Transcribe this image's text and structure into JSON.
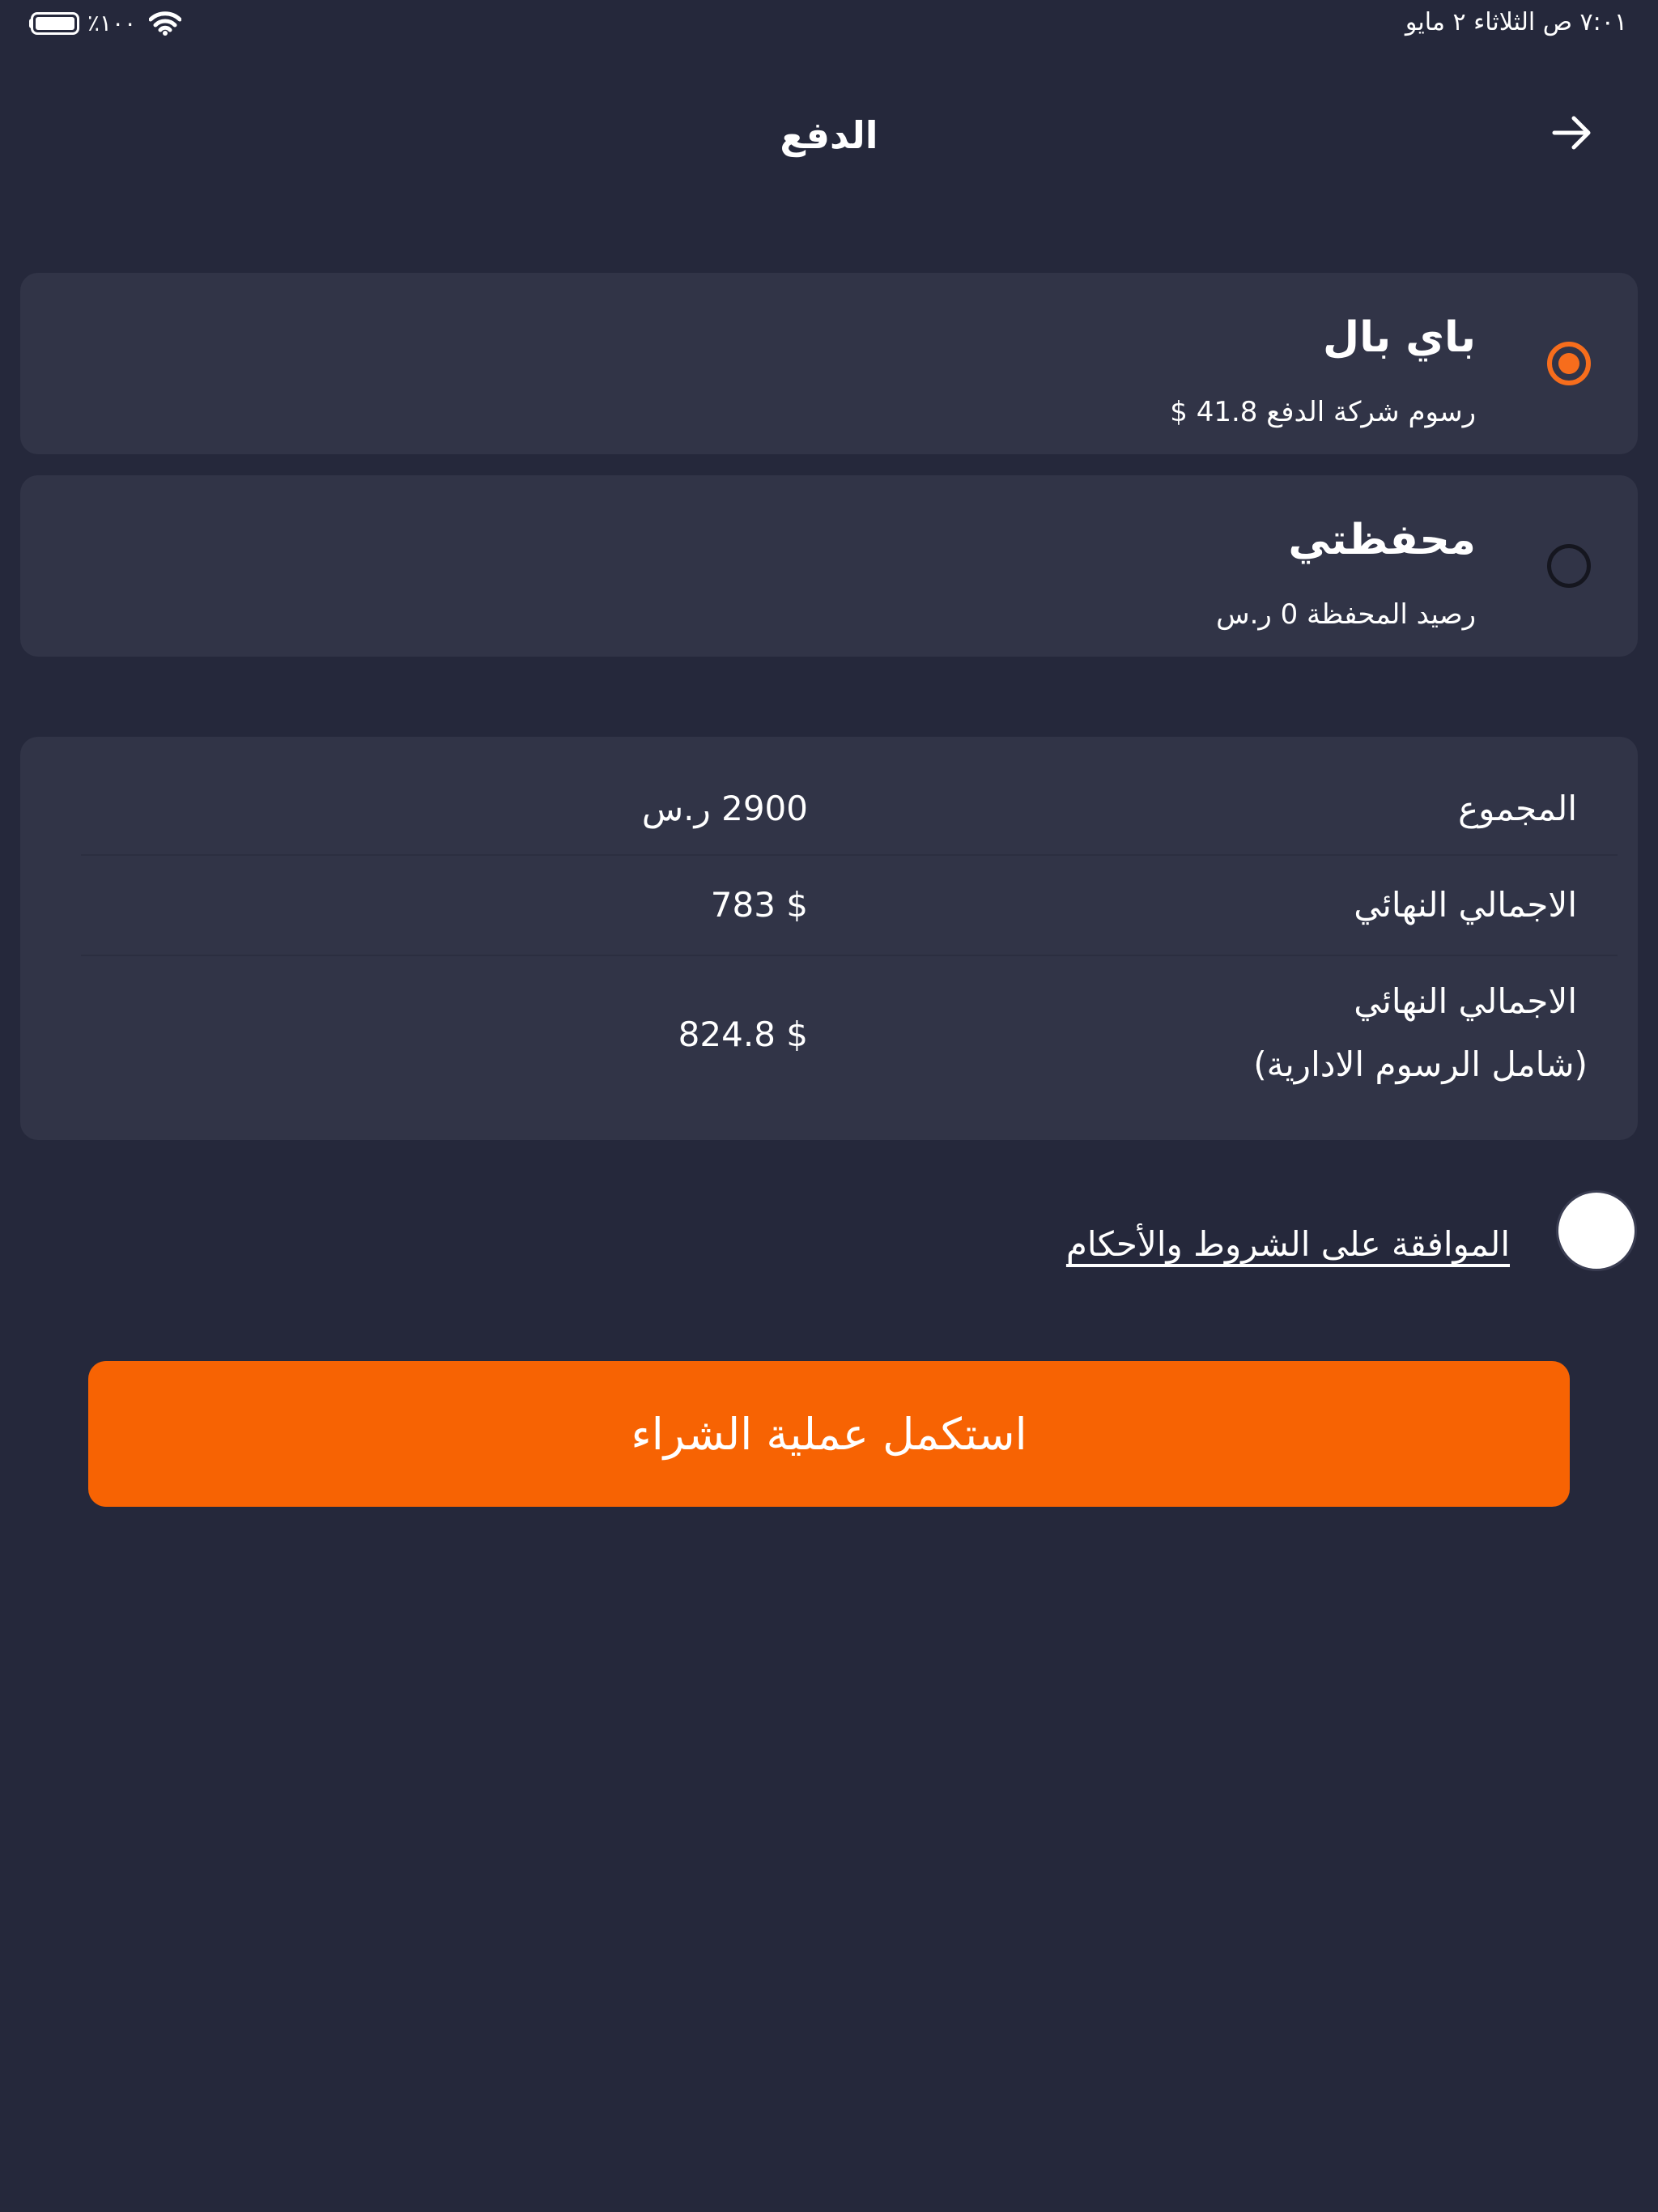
{
  "status_bar": {
    "time_date": "٧:٠١ ص   الثلاثاء ٢ مايو",
    "battery_percent": "٪١٠٠"
  },
  "header": {
    "title": "الدفع"
  },
  "payment_options": [
    {
      "title": "باي بال",
      "subtitle": "رسوم شركة الدفع 41.8 $",
      "selected": true
    },
    {
      "title": "محفظتي",
      "subtitle": "رصيد المحفظة 0 ر.س",
      "selected": false
    }
  ],
  "summary": {
    "rows": [
      {
        "label": "المجموع",
        "value": "2900 ر.س"
      },
      {
        "label": "الاجمالي النهائي",
        "value": "$ 783"
      },
      {
        "label": "الاجمالي النهائي",
        "label_line2": "(شامل الرسوم الادارية)",
        "value": "$ 824.8"
      }
    ]
  },
  "terms": {
    "label": "الموافقة على الشروط والأحكام"
  },
  "cta": {
    "label": "استكمل عملية الشراء"
  },
  "colors": {
    "background": "#25283b",
    "card": "#313447",
    "accent": "#f76303"
  },
  "icons": {
    "back": "arrow-right-icon",
    "wifi": "wifi-icon",
    "battery": "battery-icon"
  }
}
